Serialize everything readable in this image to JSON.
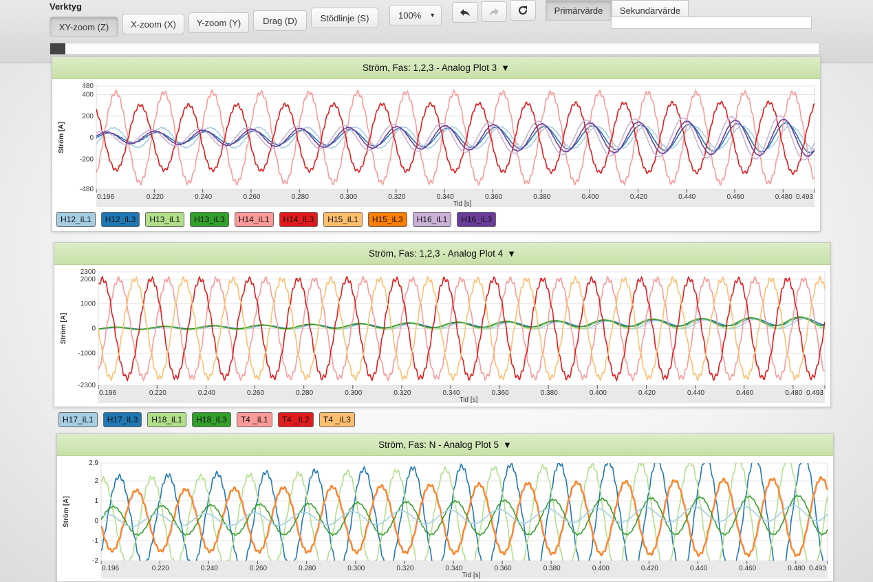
{
  "toolbar": {
    "title": "Verktyg",
    "buttons": {
      "xy_zoom": "XY-zoom (Z)",
      "x_zoom": "X-zoom (X)",
      "y_zoom": "Y-zoom (Y)",
      "drag": "Drag (D)",
      "guide": "Stödlinje (S)"
    },
    "zoom_value": "100%",
    "value_toggle": {
      "primary": "Primärvärde",
      "secondary": "Sekundärvärde"
    },
    "icons": {
      "undo": "undo-icon",
      "redo": "redo-icon",
      "refresh": "refresh-icon"
    }
  },
  "plots": [
    {
      "title": "Ström, Fas: 1,2,3 - Analog Plot 3",
      "ylabel": "Ström [A]",
      "xlabel": "Tid [s]",
      "yticks": [
        "480",
        "400",
        "200",
        "0",
        "-200",
        "-480"
      ],
      "xticks": [
        "0.196",
        "0.220",
        "0.240",
        "0.260",
        "0.280",
        "0.300",
        "0.320",
        "0.340",
        "0.360",
        "0.380",
        "0.400",
        "0.420",
        "0.440",
        "0.460",
        "0.480",
        "0.493"
      ],
      "legend": [
        {
          "label": "H12_iL1",
          "color": "#a6cee3"
        },
        {
          "label": "H12_iL3",
          "color": "#1f78b4"
        },
        {
          "label": "H13_iL1",
          "color": "#b2df8a"
        },
        {
          "label": "H13_iL3",
          "color": "#33a02c"
        },
        {
          "label": "H14_iL1",
          "color": "#fb9a99"
        },
        {
          "label": "H14_iL3",
          "color": "#e31a1c"
        },
        {
          "label": "H15_iL1",
          "color": "#fdbf6f"
        },
        {
          "label": "H15_iL3",
          "color": "#ff7f00"
        },
        {
          "label": "H16_iL1",
          "color": "#cab2d6"
        },
        {
          "label": "H16_iL3",
          "color": "#6a3d9a"
        }
      ]
    },
    {
      "title": "Ström, Fas: 1,2,3 - Analog Plot 4",
      "ylabel": "Ström [A]",
      "xlabel": "Tid [s]",
      "yticks": [
        "2300",
        "2000",
        "1000",
        "0",
        "-1000",
        "-2300"
      ],
      "xticks": [
        "0.196",
        "0.220",
        "0.240",
        "0.260",
        "0.280",
        "0.300",
        "0.320",
        "0.340",
        "0.360",
        "0.380",
        "0.400",
        "0.420",
        "0.440",
        "0.460",
        "0.480",
        "0.493"
      ],
      "legend": [
        {
          "label": "H17_iL1",
          "color": "#a6cee3"
        },
        {
          "label": "H17_iL3",
          "color": "#1f78b4"
        },
        {
          "label": "H18_iL1",
          "color": "#b2df8a"
        },
        {
          "label": "H18_iL3",
          "color": "#33a02c"
        },
        {
          "label": "T4 _iL1",
          "color": "#fb9a99"
        },
        {
          "label": "T4 _iL2",
          "color": "#e31a1c"
        },
        {
          "label": "T4 _iL3",
          "color": "#fdbf6f"
        }
      ]
    },
    {
      "title": "Ström, Fas: N - Analog Plot 5",
      "ylabel": "Ström [A]",
      "xlabel": "Tid [s]",
      "yticks": [
        "2.9",
        "2",
        "1",
        "0",
        "-1",
        "-2"
      ],
      "xticks": [
        "0.196",
        "0.220",
        "0.240",
        "0.260",
        "0.280",
        "0.300",
        "0.320",
        "0.340",
        "0.360",
        "0.380",
        "0.400",
        "0.420",
        "0.440",
        "0.460",
        "0.480",
        "0.493"
      ],
      "legend": []
    }
  ],
  "chart_data": [
    {
      "type": "line",
      "title": "Ström, Fas: 1,2,3 - Analog Plot 3",
      "xlabel": "Tid [s]",
      "ylabel": "Ström [A]",
      "xlim": [
        0.196,
        0.493
      ],
      "ylim": [
        -480,
        480
      ],
      "series": [
        {
          "name": "H12_iL1",
          "color": "#a6cee3",
          "amp": 90,
          "phase": 0.6,
          "offset": 0,
          "growth": 0.2
        },
        {
          "name": "H12_iL3",
          "color": "#1f78b4",
          "amp": 40,
          "phase": 1.2,
          "offset": 0,
          "growth": 2.5
        },
        {
          "name": "H13_iL1",
          "color": "#b2df8a",
          "amp": 0,
          "phase": 0,
          "offset": 0,
          "growth": 0
        },
        {
          "name": "H13_iL3",
          "color": "#33a02c",
          "amp": 0,
          "phase": 0,
          "offset": 0,
          "growth": 0
        },
        {
          "name": "H14_iL1",
          "color": "#fb9a99",
          "amp": 420,
          "phase": 0.3,
          "offset": 0,
          "growth": 0
        },
        {
          "name": "H14_iL3",
          "color": "#e31a1c",
          "amp": 300,
          "phase": 3.4,
          "offset": 0,
          "growth": 0.1
        },
        {
          "name": "H15_iL1",
          "color": "#fdbf6f",
          "amp": 0,
          "phase": 0,
          "offset": 0,
          "growth": 0
        },
        {
          "name": "H15_iL3",
          "color": "#ff7f00",
          "amp": 0,
          "phase": 0,
          "offset": 0,
          "growth": 0
        },
        {
          "name": "H16_iL1",
          "color": "#cab2d6",
          "amp": 60,
          "phase": 2.0,
          "offset": 0,
          "growth": 2.5
        },
        {
          "name": "H16_iL3",
          "color": "#6a3d9a",
          "amp": 50,
          "phase": 1.5,
          "offset": 0,
          "growth": 2.5
        }
      ]
    },
    {
      "type": "line",
      "title": "Ström, Fas: 1,2,3 - Analog Plot 4",
      "xlabel": "Tid [s]",
      "ylabel": "Ström [A]",
      "xlim": [
        0.196,
        0.493
      ],
      "ylim": [
        -2300,
        2300
      ],
      "series": [
        {
          "name": "H17_iL1",
          "color": "#a6cee3",
          "amp": 50,
          "phase": 0.2,
          "offset": 200,
          "growth": 3
        },
        {
          "name": "H17_iL3",
          "color": "#1f78b4",
          "amp": 40,
          "phase": 0.4,
          "offset": 300,
          "growth": 3
        },
        {
          "name": "H18_iL1",
          "color": "#b2df8a",
          "amp": 60,
          "phase": 0.6,
          "offset": 250,
          "growth": 3
        },
        {
          "name": "H18_iL3",
          "color": "#33a02c",
          "amp": 45,
          "phase": 0.8,
          "offset": 300,
          "growth": 3
        },
        {
          "name": "T4 _iL1",
          "color": "#fb9a99",
          "amp": 2000,
          "phase": 0.2,
          "offset": 0,
          "growth": 0
        },
        {
          "name": "T4 _iL2",
          "color": "#e31a1c",
          "amp": 2000,
          "phase": 2.3,
          "offset": 0,
          "growth": 0
        },
        {
          "name": "T4 _iL3",
          "color": "#fdbf6f",
          "amp": 2000,
          "phase": 4.4,
          "offset": 0,
          "growth": 0
        }
      ]
    },
    {
      "type": "line",
      "title": "Ström, Fas: N - Analog Plot 5",
      "xlabel": "Tid [s]",
      "ylabel": "Ström [A]",
      "xlim": [
        0.196,
        0.493
      ],
      "ylim": [
        -2,
        2.9
      ],
      "series": [
        {
          "name": "",
          "color": "#1f78b4",
          "amp": 2.2,
          "phase": 0.5,
          "offset": 0.2,
          "growth": 0.4
        },
        {
          "name": "",
          "color": "#b2df8a",
          "amp": 2.1,
          "phase": 2.6,
          "offset": 0.2,
          "growth": 0.4
        },
        {
          "name": "",
          "color": "#fb9a99",
          "amp": 1.5,
          "phase": 4.5,
          "offset": 0.2,
          "growth": 0.3
        },
        {
          "name": "",
          "color": "#ff7f00",
          "amp": 1.5,
          "phase": 4.6,
          "offset": 0.2,
          "growth": 0.3
        },
        {
          "name": "",
          "color": "#33a02c",
          "amp": 0.7,
          "phase": 1.3,
          "offset": 0.3,
          "growth": 0.4
        },
        {
          "name": "",
          "color": "#a6cee3",
          "amp": 0.3,
          "phase": 2.0,
          "offset": 0.4,
          "growth": 0.3
        }
      ]
    }
  ]
}
